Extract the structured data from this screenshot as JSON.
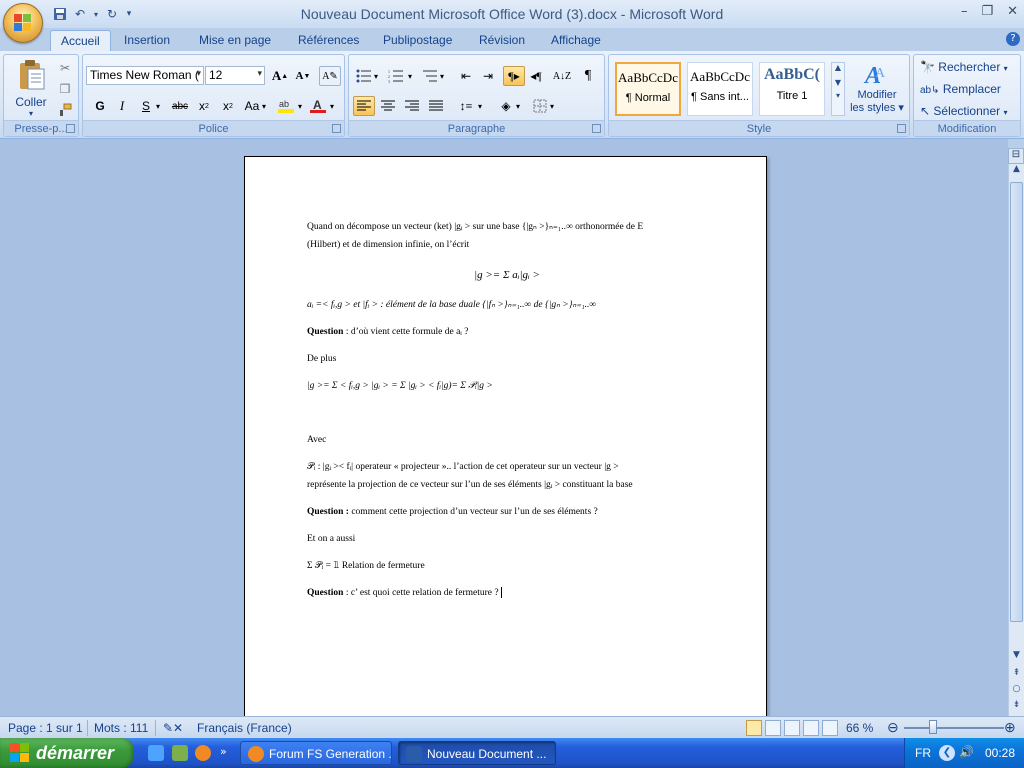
{
  "window": {
    "title": "Nouveau Document Microsoft Office Word (3).docx - Microsoft Word",
    "minimize_icon": "minimize-icon",
    "restore_icon": "restore-icon",
    "close_icon": "close-icon"
  },
  "ribbon_tabs": [
    "Accueil",
    "Insertion",
    "Mise en page",
    "Références",
    "Publipostage",
    "Révision",
    "Affichage"
  ],
  "clipboard": {
    "paste_label": "Coller",
    "group_label": "Presse-p..."
  },
  "font": {
    "font_name": "Times New Roman (",
    "font_size": "12",
    "group_label": "Police",
    "bold": "G",
    "italic": "I",
    "underline": "S",
    "strike": "abc",
    "change_case": "Aa"
  },
  "paragraph": {
    "group_label": "Paragraphe"
  },
  "styles": {
    "group_label": "Style",
    "items": [
      {
        "sample": "AaBbCcDc",
        "name": "¶ Normal"
      },
      {
        "sample": "AaBbCcDc",
        "name": "¶ Sans int..."
      },
      {
        "sample": "AaBbC(",
        "name": "Titre 1"
      }
    ],
    "modify_label_1": "Modifier",
    "modify_label_2": "les styles"
  },
  "editing": {
    "group_label": "Modification",
    "find": "Rechercher",
    "replace": "Remplacer",
    "select": "Sélectionner"
  },
  "document": {
    "p1a": "Quand on décompose un vecteur (ket) |gᵢ > sur une base {|gₙ >}ₙ₌₁..∞ orthonormée de E",
    "p1b": "(Hilbert)  et de dimension infinie, on l’écrit",
    "eq1": "|g >= Σ aᵢ|gᵢ >",
    "p2": "aᵢ =< fᵢ,g > et |fᵢ > : élément de la base duale {|fₙ >}ₙ₌₁..∞ de {|gₙ >}ₙ₌₁..∞",
    "q1_label": "Question",
    "q1_text": " : d’où vient cette formule de aᵢ ?",
    "p3": "De plus",
    "p4": "|g >= Σ < fᵢ,g > |gᵢ >  = Σ |gᵢ > < fᵢ|g)= Σ 𝒫ᵢ|g >",
    "p5": "Avec",
    "p6a": "𝒫ᵢ : |gᵢ >< fᵢ| operateur « projecteur ».. l’action de cet operateur sur un vecteur |g >",
    "p6b": "représente la projection de ce  vecteur sur l’un de ses éléments |gᵢ >  constituant la base",
    "q2_label": "Question :",
    "q2_text": " comment cette projection d’un vecteur sur l’un de ses éléments ?",
    "p7": "Et on a aussi",
    "p8": "Σ 𝒫ᵢ = 𝟙 Relation de fermeture",
    "q3_label": "Question",
    "q3_text": " : c’ est quoi cette relation de fermeture ?"
  },
  "status": {
    "page": "Page : 1 sur 1",
    "words": "Mots : 111",
    "language": "Français (France)",
    "zoom": "66 %",
    "zoom_level": 66
  },
  "taskbar": {
    "start": "démarrer",
    "tasks": [
      "Forum FS Generation ...",
      "Nouveau Document ..."
    ],
    "lang": "FR",
    "clock": "00:28"
  },
  "colors": {
    "ribbon": "#d6e4f5",
    "taskbar": "#245edb",
    "start": "#3c9b3c",
    "doc_bg": "#a8c0e2"
  }
}
